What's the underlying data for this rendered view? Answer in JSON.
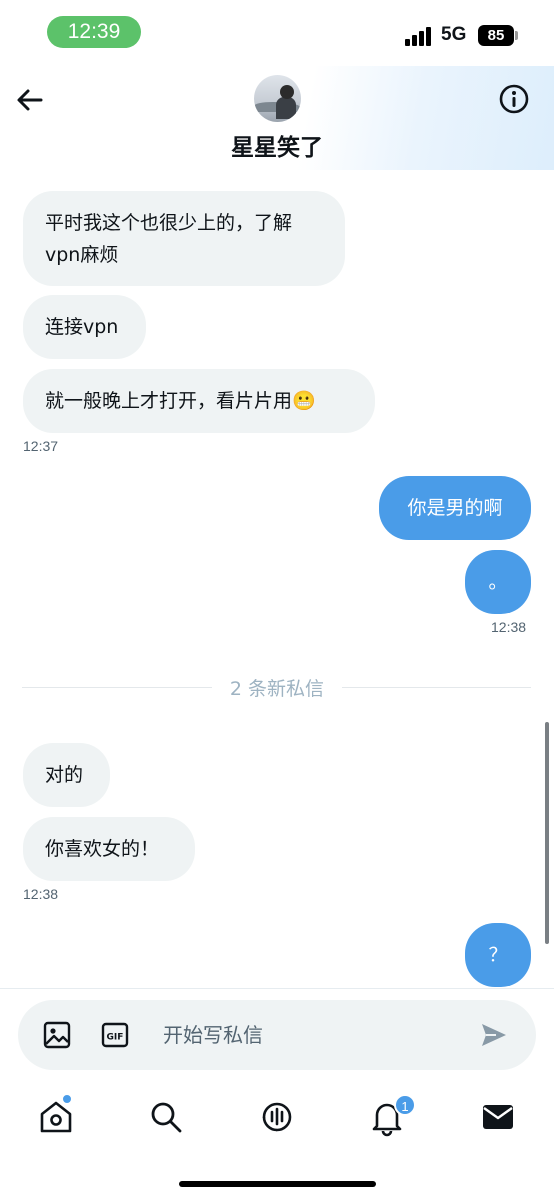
{
  "status_bar": {
    "time": "12:39",
    "network": "5G",
    "battery": "85"
  },
  "header": {
    "contact_name": "星星笑了"
  },
  "messages": [
    {
      "text_line1": "平时我这个也很少上的，了解",
      "text_line2": "vpn麻烦"
    },
    {
      "text": "连接vpn"
    },
    {
      "text": "就一般晚上才打开，看片片用😬",
      "time": "12:37"
    },
    {
      "text": "你是男的啊"
    },
    {
      "text": "。",
      "time": "12:38"
    },
    {
      "text": "对的"
    },
    {
      "text": "你喜欢女的！",
      "time": "12:38"
    },
    {
      "text": "？"
    }
  ],
  "divider": {
    "label": "2 条新私信"
  },
  "composer": {
    "placeholder": "开始写私信"
  },
  "nav": {
    "notifications_badge": "1"
  },
  "colors": {
    "outgoing": "#4a9ce8",
    "incoming": "#eff3f4",
    "time_pill": "#5cc26a"
  }
}
